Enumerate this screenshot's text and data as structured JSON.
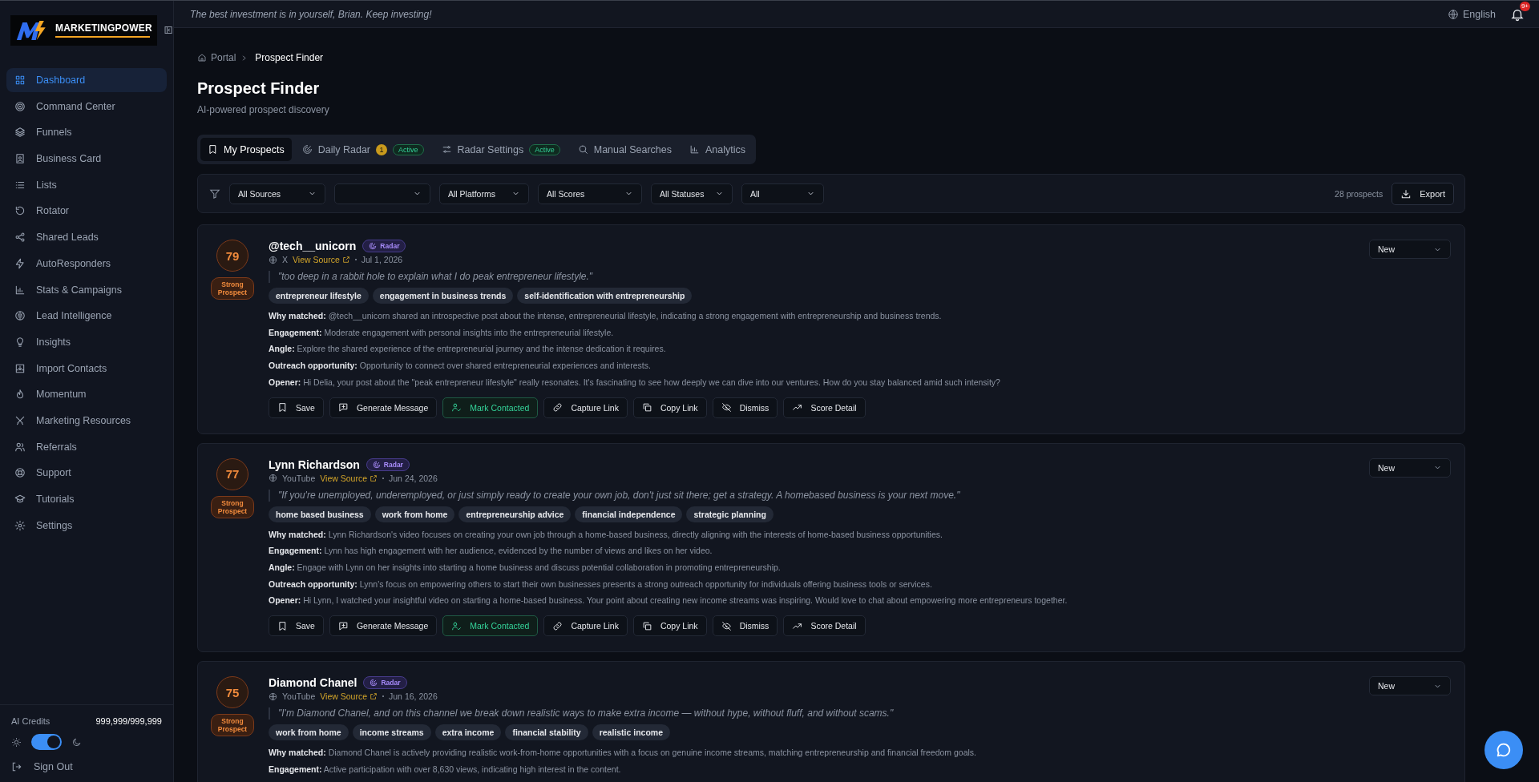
{
  "logo": {
    "text": "MARKETINGPOWER"
  },
  "sidebar": {
    "items": [
      {
        "label": "Dashboard",
        "selected": true
      },
      {
        "label": "Command Center",
        "selected": false
      },
      {
        "label": "Funnels",
        "selected": false
      },
      {
        "label": "Business Card",
        "selected": false
      },
      {
        "label": "Lists",
        "selected": false
      },
      {
        "label": "Rotator",
        "selected": false
      },
      {
        "label": "Shared Leads",
        "selected": false
      },
      {
        "label": "AutoResponders",
        "selected": false
      },
      {
        "label": "Stats & Campaigns",
        "selected": false
      },
      {
        "label": "Lead Intelligence",
        "selected": false
      },
      {
        "label": "Insights",
        "selected": false
      },
      {
        "label": "Import Contacts",
        "selected": false
      },
      {
        "label": "Momentum",
        "selected": false
      },
      {
        "label": "Marketing Resources",
        "selected": false
      },
      {
        "label": "Referrals",
        "selected": false
      },
      {
        "label": "Support",
        "selected": false
      },
      {
        "label": "Tutorials",
        "selected": false
      },
      {
        "label": "Settings",
        "selected": false
      }
    ],
    "credits": {
      "label": "AI Credits",
      "value": "999,999/999,999"
    },
    "dark_mode": {
      "on": true
    },
    "sign_out": "Sign Out"
  },
  "header": {
    "motto": "The best investment is in yourself, Brian. Keep investing!",
    "language": "English",
    "notification_badge": "9+"
  },
  "breadcrumb": [
    "Portal",
    "Prospect Finder"
  ],
  "page": {
    "title": "Prospect Finder",
    "subtitle": "AI-powered prospect discovery"
  },
  "tabs": [
    {
      "label": "My Prospects",
      "selected": true
    },
    {
      "label": "Daily Radar",
      "selected": false,
      "count": "1",
      "status": "Active"
    },
    {
      "label": "Radar Settings",
      "selected": false,
      "status": "Active"
    },
    {
      "label": "Manual Searches",
      "selected": false
    },
    {
      "label": "Analytics",
      "selected": false
    }
  ],
  "filters": [
    {
      "kind": "select",
      "value": "All Sources"
    },
    {
      "kind": "select"
    },
    {
      "kind": "select",
      "value": "All Platforms"
    },
    {
      "kind": "select",
      "value": "All Scores"
    },
    {
      "kind": "select",
      "value": "All Statuses"
    },
    {
      "kind": "select",
      "value": "All"
    }
  ],
  "prospect_count": "28 prospects",
  "export_button": "Export",
  "prospects": [
    {
      "score": "79",
      "score_label": "Strong Prospect",
      "name": "@tech__unicorn",
      "badge": "Radar",
      "platform": "X",
      "source_link": "View Source",
      "date": "Jul 1, 2026",
      "status": "New",
      "quote": "\"too deep in a rabbit hole to explain what I do peak entrepreneur lifestyle.\"",
      "tags": [
        "entrepreneur lifestyle",
        "engagement in business trends",
        "self-identification with entrepreneurship"
      ],
      "details": [
        "**Why matched:** @tech__unicorn shared an introspective post about the intense, entrepreneurial lifestyle, indicating a strong engagement with entrepreneurship and business trends.",
        "**Engagement:** Moderate engagement with personal insights into the entrepreneurial lifestyle.",
        "**Angle:** Explore the shared experience of the entrepreneurial journey and the intense dedication it requires.",
        "**Outreach opportunity:** Opportunity to connect over shared entrepreneurial experiences and interests.",
        "**Opener:** Hi Delia, your post about the \"peak entrepreneur lifestyle\" really resonates. It's fascinating to see how deeply we can dive into our ventures. How do you stay balanced amid such intensity?"
      ],
      "actions": [
        {
          "label": "Save",
          "highlighted": false
        },
        {
          "label": "Generate Message",
          "highlighted": false
        },
        {
          "label": "Mark Contacted",
          "highlighted": true
        },
        {
          "label": "Capture Link",
          "highlighted": false
        },
        {
          "label": "Copy Link",
          "highlighted": false
        },
        {
          "label": "Dismiss",
          "highlighted": false
        },
        {
          "label": "Score Detail",
          "highlighted": false
        }
      ]
    },
    {
      "score": "77",
      "score_label": "Strong Prospect",
      "name": "Lynn Richardson",
      "badge": "Radar",
      "platform": "YouTube",
      "source_link": "View Source",
      "date": "Jun 24, 2026",
      "status": "New",
      "quote": "\"If you're unemployed, underemployed, or just simply ready to create your own job, don't just sit there; get a strategy. A homebased business is your next move.\"",
      "tags": [
        "home based business",
        "work from home",
        "entrepreneurship advice",
        "financial independence",
        "strategic planning"
      ],
      "details": [
        "**Why matched:** Lynn Richardson's video focuses on creating your own job through a home-based business, directly aligning with the interests of home-based business opportunities.",
        "**Engagement:** Lynn has high engagement with her audience, evidenced by the number of views and likes on her video.",
        "**Angle:** Engage with Lynn on her insights into starting a home business and discuss potential collaboration in promoting entrepreneurship.",
        "**Outreach opportunity:** Lynn's focus on empowering others to start their own businesses presents a strong outreach opportunity for individuals offering business tools or services.",
        "**Opener:** Hi Lynn, I watched your insightful video on starting a home-based business. Your point about creating new income streams was inspiring. Would love to chat about empowering more entrepreneurs together."
      ],
      "actions": [
        {
          "label": "Save",
          "highlighted": false
        },
        {
          "label": "Generate Message",
          "highlighted": false
        },
        {
          "label": "Mark Contacted",
          "highlighted": true
        },
        {
          "label": "Capture Link",
          "highlighted": false
        },
        {
          "label": "Copy Link",
          "highlighted": false
        },
        {
          "label": "Dismiss",
          "highlighted": false
        },
        {
          "label": "Score Detail",
          "highlighted": false
        }
      ]
    },
    {
      "score": "75",
      "score_label": "Strong Prospect",
      "name": "Diamond Chanel",
      "badge": "Radar",
      "platform": "YouTube",
      "source_link": "View Source",
      "date": "Jun 16, 2026",
      "status": "New",
      "quote": "\"I'm Diamond Chanel, and on this channel we break down realistic ways to make extra income — without hype, without fluff, and without scams.\"",
      "tags": [
        "work from home",
        "income streams",
        "extra income",
        "financial stability",
        "realistic income"
      ],
      "details": [
        "**Why matched:** Diamond Chanel is actively providing realistic work-from-home opportunities with a focus on genuine income streams, matching entrepreneurship and financial freedom goals.",
        "**Engagement:** Active participation with over 8,630 views, indicating high interest in the content."
      ]
    }
  ]
}
